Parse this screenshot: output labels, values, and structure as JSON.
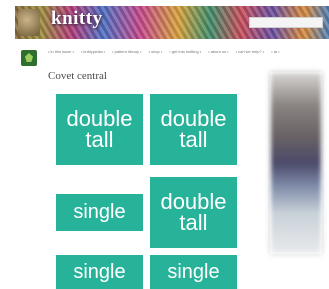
{
  "banner": {
    "logo": "knitty",
    "search_placeholder": ""
  },
  "nav": {
    "items": [
      "• in this issue •",
      "• knittypedia •",
      "• pattern library •",
      "• shop •",
      "• get into knitting •",
      "• about us •",
      "• can we help? •",
      "• ta •"
    ]
  },
  "page": {
    "title": "Covet central"
  },
  "tiles": [
    {
      "label": "double\ntall"
    },
    {
      "label": "double\ntall"
    },
    {
      "label": "single"
    },
    {
      "label": "double\ntall"
    },
    {
      "label": "single"
    },
    {
      "label": "single"
    }
  ],
  "colors": {
    "tile": "#27b29a",
    "title": "#4a4a4a"
  }
}
